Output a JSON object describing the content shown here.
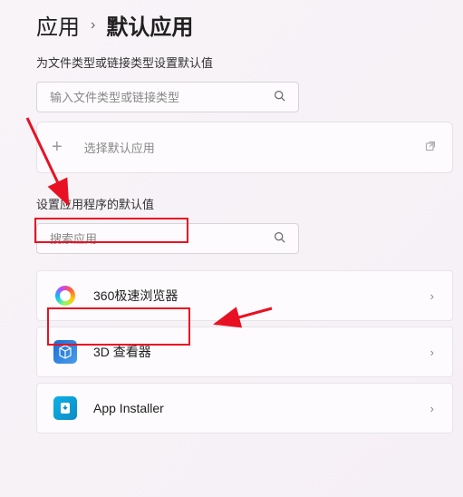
{
  "breadcrumb": {
    "parent": "应用",
    "current": "默认应用"
  },
  "subtitle": "为文件类型或链接类型设置默认值",
  "search_filetype": {
    "placeholder": "输入文件类型或链接类型"
  },
  "select_default": {
    "label": "选择默认应用"
  },
  "section_title": "设置应用程序的默认值",
  "search_apps": {
    "placeholder": "搜索应用"
  },
  "apps": [
    {
      "name": "360极速浏览器",
      "icon": "360-icon"
    },
    {
      "name": "3D 查看器",
      "icon": "cube-icon"
    },
    {
      "name": "App Installer",
      "icon": "appinstaller-icon"
    }
  ],
  "highlights": {
    "target_section": true,
    "target_app_index": 0
  }
}
